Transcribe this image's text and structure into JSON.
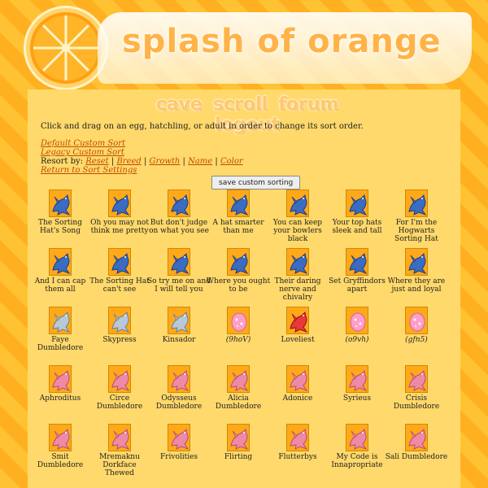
{
  "site": {
    "title": "splash of orange"
  },
  "nav": [
    "cave",
    "scroll",
    "forum",
    "logout"
  ],
  "instructions": "Click and drag on an egg, hatchling, or adult in order to change its sort order.",
  "links": {
    "default_custom_sort": "Default Custom Sort",
    "legacy_custom_sort": "Legacy Custom Sort",
    "resort_by_label": "Resort by:",
    "resort_options": [
      "Reset",
      "Breed",
      "Growth",
      "Name",
      "Color"
    ],
    "return_to_sort_settings": "Return to Sort Settings"
  },
  "save_button": "save custom sorting",
  "colors": {
    "orange": "#ff9f12",
    "blue": "#3a6cc2",
    "grey": "#b8c8d6",
    "red": "#e8383a",
    "pink": "#ff9ec8",
    "pink_dragon": "#ee8aa8"
  },
  "dragons": [
    {
      "name": "The Sorting Hat's Song",
      "sprite": "blue-hatchling-icon"
    },
    {
      "name": "Oh you may not think me pretty",
      "sprite": "blue-dragon-icon"
    },
    {
      "name": "But don't judge on what you see",
      "sprite": "blue-dragon-icon"
    },
    {
      "name": "A hat smarter than me",
      "sprite": "blue-dragon-icon"
    },
    {
      "name": "You can keep your bowlers black",
      "sprite": "blue-dragon-icon"
    },
    {
      "name": "Your top hats sleek and tall",
      "sprite": "blue-dragon-icon"
    },
    {
      "name": "For I'm the Hogwarts Sorting Hat",
      "sprite": "blue-dragon-icon"
    },
    {
      "name": "And I can cap them all",
      "sprite": "blue-dragon-icon"
    },
    {
      "name": "The Sorting Hat can't see",
      "sprite": "blue-dragon-icon"
    },
    {
      "name": "So try me on and I will tell you",
      "sprite": "blue-dragon-icon"
    },
    {
      "name": "Where you ought to be",
      "sprite": "blue-dragon-icon"
    },
    {
      "name": "Their daring nerve and chivalry",
      "sprite": "blue-dragon-icon"
    },
    {
      "name": "Set Gryffindors apart",
      "sprite": "blue-dragon-icon"
    },
    {
      "name": "Where they are just and loyal",
      "sprite": "blue-dragon-icon"
    },
    {
      "name": "Faye Dumbledore",
      "sprite": "grey-hatchling-icon"
    },
    {
      "name": "Skypress",
      "sprite": "grey-hatchling-icon"
    },
    {
      "name": "Kinsador",
      "sprite": "grey-hatchling-icon"
    },
    {
      "name": "(9hoV)",
      "sprite": "pink-egg-icon",
      "code": true
    },
    {
      "name": "Loveliest",
      "sprite": "red-hatchling-icon"
    },
    {
      "name": "(o9vh)",
      "sprite": "pink-egg-icon",
      "code": true
    },
    {
      "name": "(gfn5)",
      "sprite": "pink-egg-icon",
      "code": true
    },
    {
      "name": "Aphroditus",
      "sprite": "pink-dragon-icon"
    },
    {
      "name": "Circe Dumbledore",
      "sprite": "pink-dragon-icon"
    },
    {
      "name": "Odysseus Dumbledore",
      "sprite": "pink-dragon-icon"
    },
    {
      "name": "Alicia Dumbledore",
      "sprite": "pink-dragon-icon"
    },
    {
      "name": "Adonice",
      "sprite": "pink-dragon-icon"
    },
    {
      "name": "Syrieus",
      "sprite": "pink-dragon-icon"
    },
    {
      "name": "Crisis Dumbledore",
      "sprite": "pink-dragon-icon"
    },
    {
      "name": "Smit Dumbledore",
      "sprite": "pink-dragon-icon"
    },
    {
      "name": "Mremaknu Dorkface Thewed",
      "sprite": "pink-dragon-icon"
    },
    {
      "name": "Frivolities",
      "sprite": "pink-dragon-icon"
    },
    {
      "name": "Flirting",
      "sprite": "pink-dragon-icon"
    },
    {
      "name": "Flutterbys",
      "sprite": "pink-dragon-icon"
    },
    {
      "name": "My Code is Innapropriate",
      "sprite": "pink-dragon-icon"
    },
    {
      "name": "Sali Dumbledore",
      "sprite": "pink-dragon-icon"
    }
  ]
}
